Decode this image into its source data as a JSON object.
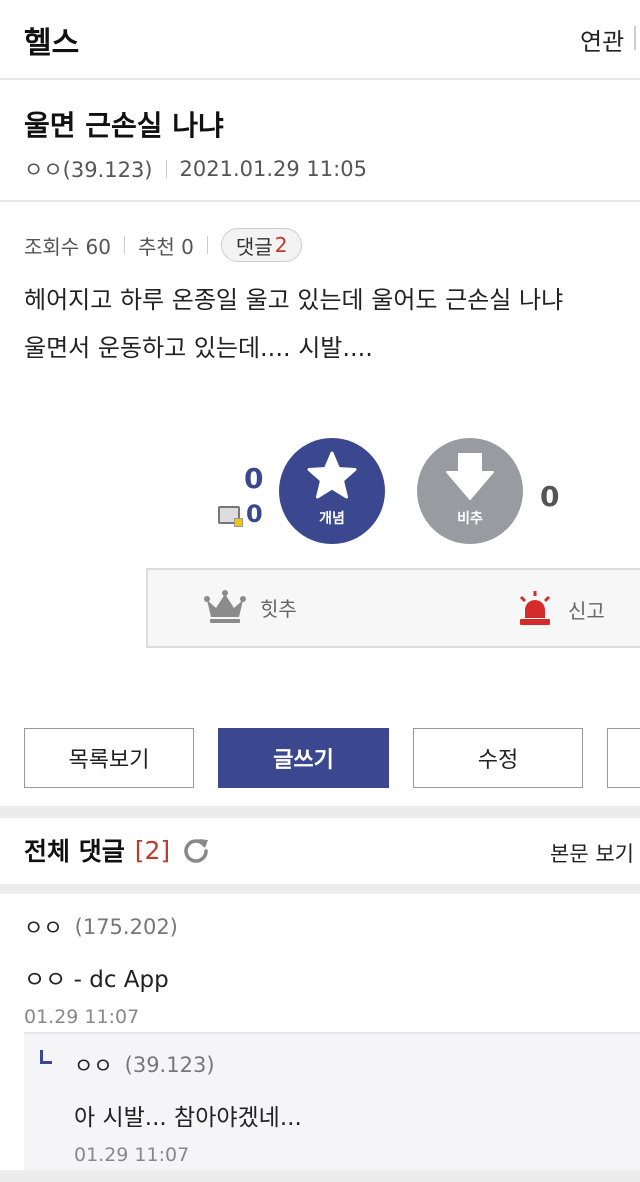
{
  "header": {
    "board_title": "헬스",
    "related_label": "연관"
  },
  "post": {
    "title": "울면 근손실 나냐",
    "author": "ㅇㅇ(39.123)",
    "datetime": "2021.01.29 11:05",
    "views_label": "조회수 60",
    "recommend_label": "추천 0",
    "comments_pill_label": "댓글",
    "comments_pill_count": "2",
    "body_lines": [
      "헤어지고 하루 온종일 울고 있는데 울어도 근손실 나냐",
      "울면서 운동하고 있는데.... 시발...."
    ]
  },
  "votes": {
    "up_count": "0",
    "image_count": "0",
    "up_label": "개념",
    "down_label": "비추",
    "down_count": "0",
    "up_color": "#3b4890",
    "down_color": "#9a9ba1"
  },
  "actions": {
    "best_label": "힛추",
    "report_label": "신고"
  },
  "buttons": {
    "list": "목록보기",
    "write": "글쓰기",
    "edit": "수정"
  },
  "comments": {
    "header": "전체 댓글",
    "count": "[2]",
    "view_body": "본문 보기",
    "items": [
      {
        "nick": "ㅇㅇ",
        "ip": "(175.202)",
        "text": "ㅇㅇ - dc App",
        "time": "01.29 11:07"
      }
    ],
    "reply": {
      "nick": "ㅇㅇ",
      "ip": "(39.123)",
      "text": "아 시발... 참아야겠네...",
      "time": "01.29 11:07"
    }
  }
}
